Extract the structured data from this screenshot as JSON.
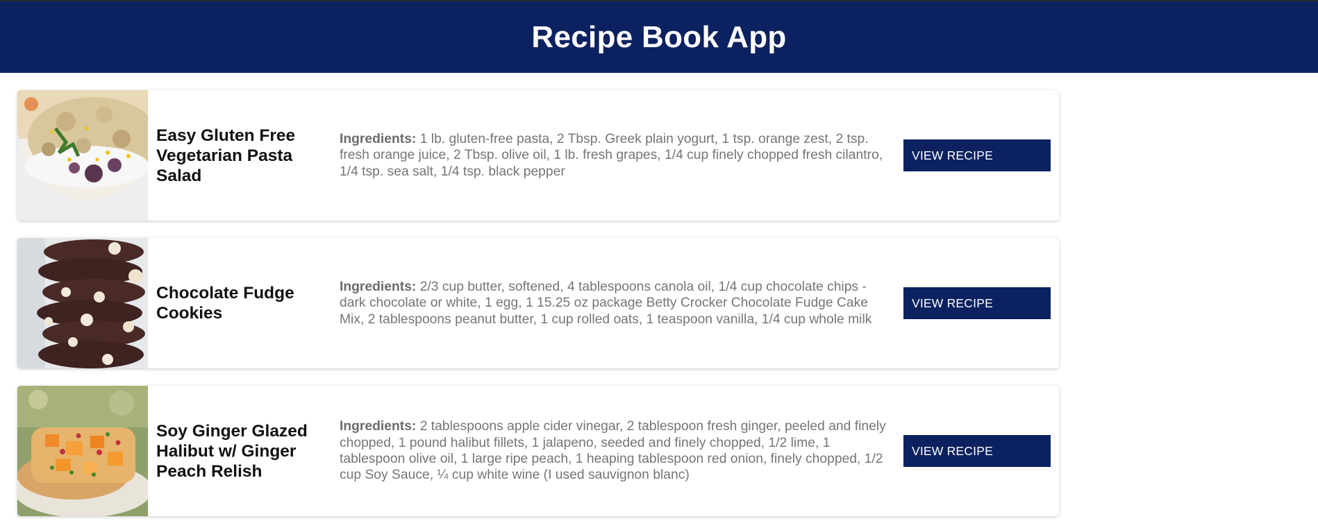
{
  "app": {
    "title": "Recipe Book App"
  },
  "recipes": [
    {
      "name": "Easy Gluten Free Vegetarian Pasta Salad",
      "ingredients_label": "Ingredients:",
      "ingredients": "1 lb. gluten-free pasta, 2 Tbsp. Greek plain yogurt, 1 tsp. orange zest, 2 tsp. fresh orange juice, 2 Tbsp. olive oil, 1 lb. fresh grapes, 1/4 cup finely chopped fresh cilantro, 1/4 tsp. sea salt, 1/4 tsp. black pepper",
      "button_label": "VIEW RECIPE"
    },
    {
      "name": "Chocolate Fudge Cookies",
      "ingredients_label": "Ingredients:",
      "ingredients": "2/3 cup butter, softened, 4 tablespoons canola oil, 1/4 cup chocolate chips - dark chocolate or white, 1 egg, 1 15.25 oz package Betty Crocker Chocolate Fudge Cake Mix, 2 tablespoons peanut butter, 1 cup rolled oats, 1 teaspoon vanilla, 1/4 cup whole milk",
      "button_label": "VIEW RECIPE"
    },
    {
      "name": "Soy Ginger Glazed Halibut w/ Ginger Peach Relish",
      "ingredients_label": "Ingredients:",
      "ingredients": "2 tablespoons apple cider vinegar, 2 tablespoon fresh ginger, peeled and finely chopped, 1 pound halibut fillets, 1 jalapeno, seeded and finely chopped, 1/2 lime, 1 tablespoon olive oil, 1 large ripe peach, 1 heaping tablespoon red onion, finely chopped, 1/2 cup Soy Sauce, ¼ cup white wine (I used sauvignon blanc)",
      "button_label": "VIEW RECIPE"
    }
  ],
  "colors": {
    "brand": "#0c2260",
    "text": "#111111",
    "muted": "#757575"
  }
}
